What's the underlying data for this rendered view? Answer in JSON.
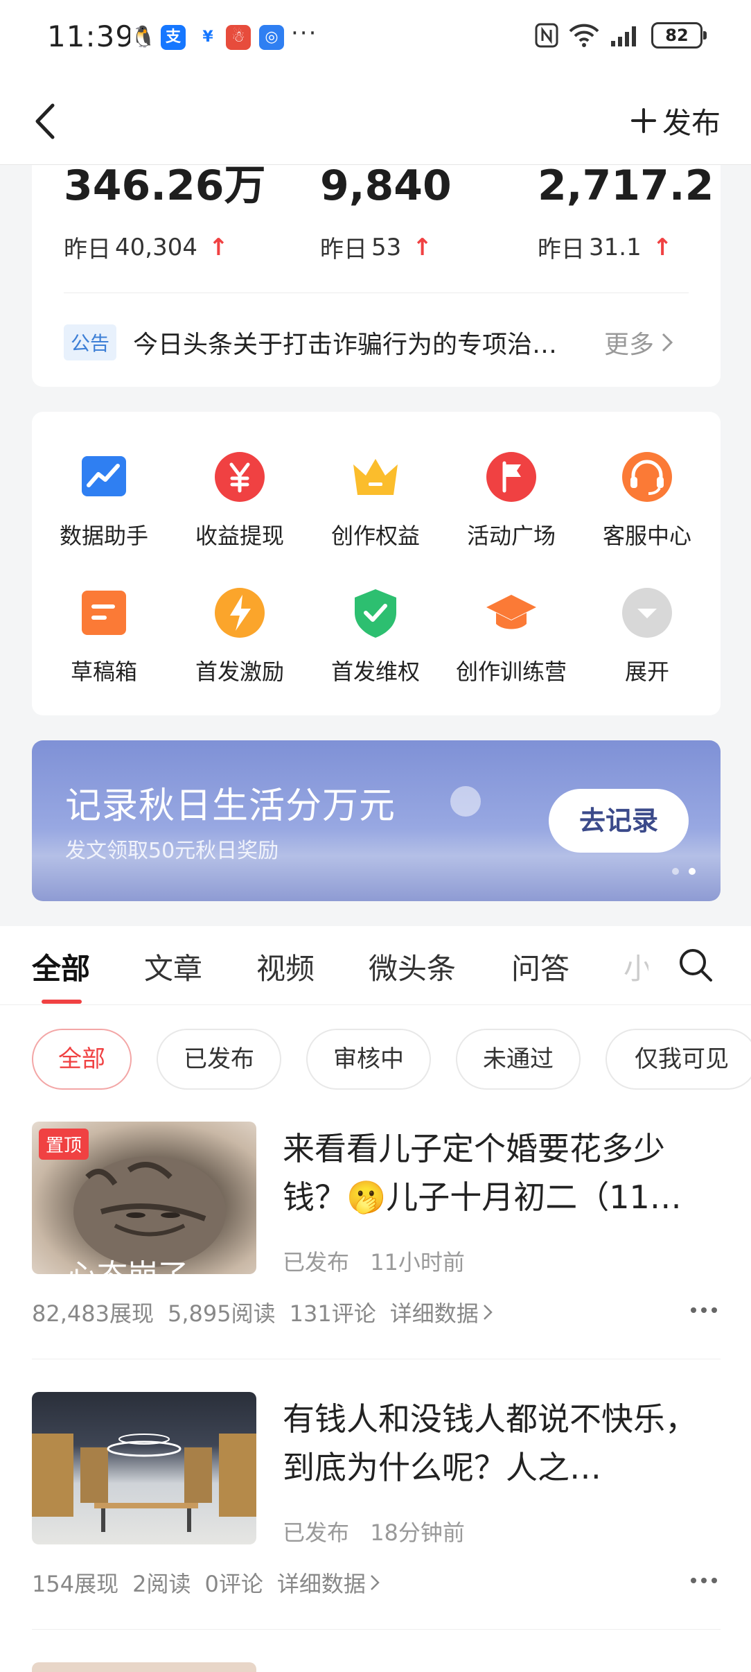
{
  "status_bar": {
    "time": "11:39",
    "more": "···",
    "battery": "82"
  },
  "nav": {
    "publish_label": "发布"
  },
  "stats": [
    {
      "value": "346.26万",
      "yesterday_label": "昨日",
      "yesterday_value": "40,304"
    },
    {
      "value": "9,840",
      "yesterday_label": "昨日",
      "yesterday_value": "53"
    },
    {
      "value": "2,717.2",
      "yesterday_label": "昨日",
      "yesterday_value": "31.1"
    }
  ],
  "notice": {
    "tag": "公告",
    "text": "今日头条关于打击诈骗行为的专项治…",
    "more": "更多"
  },
  "tools": [
    {
      "label": "数据助手",
      "icon": "chart-icon"
    },
    {
      "label": "收益提现",
      "icon": "yuan-icon"
    },
    {
      "label": "创作权益",
      "icon": "crown-icon"
    },
    {
      "label": "活动广场",
      "icon": "flag-icon"
    },
    {
      "label": "客服中心",
      "icon": "headset-icon"
    },
    {
      "label": "草稿箱",
      "icon": "draft-icon"
    },
    {
      "label": "首发激励",
      "icon": "lightning-icon"
    },
    {
      "label": "首发维权",
      "icon": "shield-check-icon"
    },
    {
      "label": "创作训练营",
      "icon": "graduation-cap-icon"
    },
    {
      "label": "展开",
      "icon": "expand-icon"
    }
  ],
  "banner": {
    "title": "记录秋日生活分万元",
    "subtitle": "发文领取50元秋日奖励",
    "button": "去记录"
  },
  "tabs": [
    "全部",
    "文章",
    "视频",
    "微头条",
    "问答",
    "小"
  ],
  "filters": [
    "全部",
    "已发布",
    "审核中",
    "未通过",
    "仅我可见"
  ],
  "articles": [
    {
      "pin": "置顶",
      "thumb_caption": "心态崩了",
      "title": "来看看儿子定个婚要花多少钱？🫢儿子十月初二（11…",
      "status": "已发布",
      "time": "11小时前",
      "impressions": "82,483展现",
      "reads": "5,895阅读",
      "comments": "131评论",
      "detail": "详细数据"
    },
    {
      "title": "有钱人和没钱人都说不快乐，到底为什么呢？人之…",
      "status": "已发布",
      "time": "18分钟前",
      "impressions": "154展现",
      "reads": "2阅读",
      "comments": "0评论",
      "detail": "详细数据"
    }
  ],
  "colors": {
    "accent": "#f04142",
    "link_blue": "#3d7fd6",
    "banner": "#8e9fdc"
  }
}
